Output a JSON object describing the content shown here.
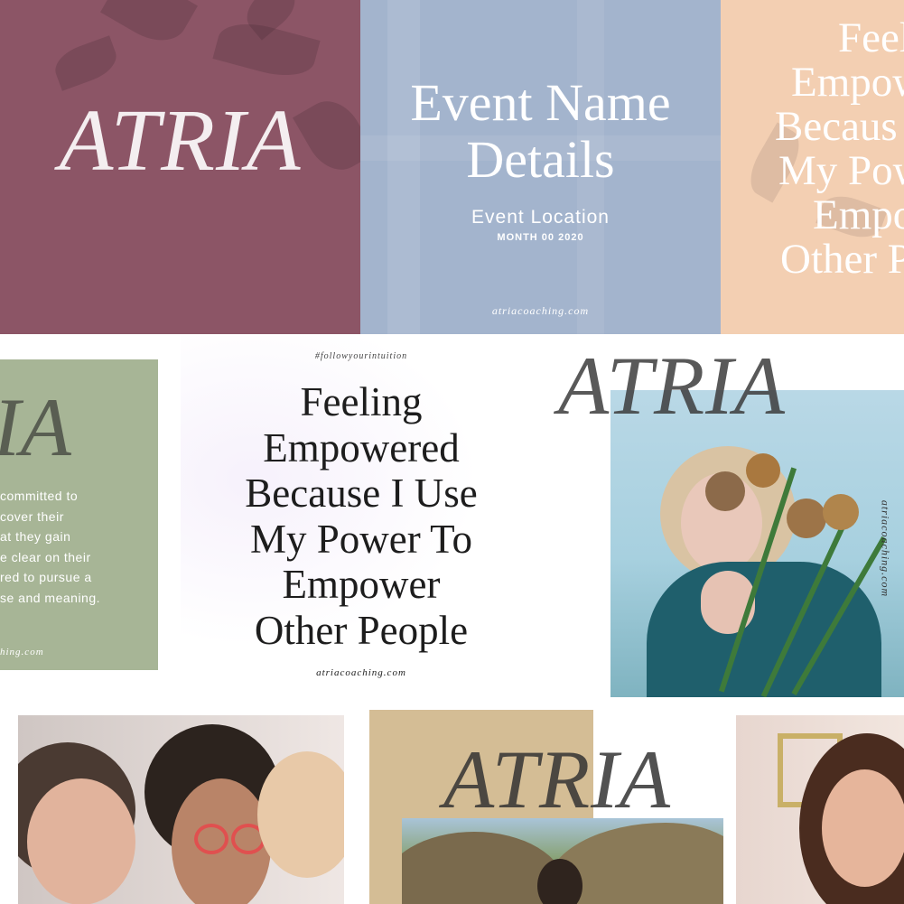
{
  "colors": {
    "mauve": "#8c5566",
    "blue": "#a3b4cd",
    "peach": "#f3cfb2",
    "sage": "#a7b596",
    "tan": "#d4bd95",
    "text_dark": "#1d1d1d",
    "text_grey": "#6a6a6a"
  },
  "tile_mauve": {
    "logo": "ATRIA"
  },
  "tile_blue": {
    "title_line1": "Event Name",
    "title_line2": "Details",
    "location": "Event Location",
    "date": "MONTH 00 2020",
    "url": "atriacoaching.com"
  },
  "tile_peach": {
    "lines": [
      "Feel",
      "Empow",
      "Becaus",
      "My Pow",
      "Empo",
      "Other P"
    ]
  },
  "tile_sage": {
    "logo": "IA",
    "body_lines": [
      "committed to",
      "cover their",
      "at they gain",
      "e clear on their",
      "red to pursue a",
      "se and meaning."
    ],
    "url": "hing.com"
  },
  "tile_quote": {
    "hashtag": "#followyourintuition",
    "lines": [
      "Feeling",
      "Empowered",
      "Because I Use",
      "My Power To",
      "Empower",
      "Other People"
    ],
    "url": "atriacoaching.com"
  },
  "tile_photo_flowers": {
    "logo": "ATRIA",
    "vertical_url": "atriacoaching.com",
    "icon": "portrait-photo"
  },
  "tile_friends": {
    "icon": "group-photo"
  },
  "tile_tan": {
    "logo": "ATRIA",
    "icon": "landscape-photo"
  },
  "tile_smile": {
    "icon": "portrait-photo"
  }
}
